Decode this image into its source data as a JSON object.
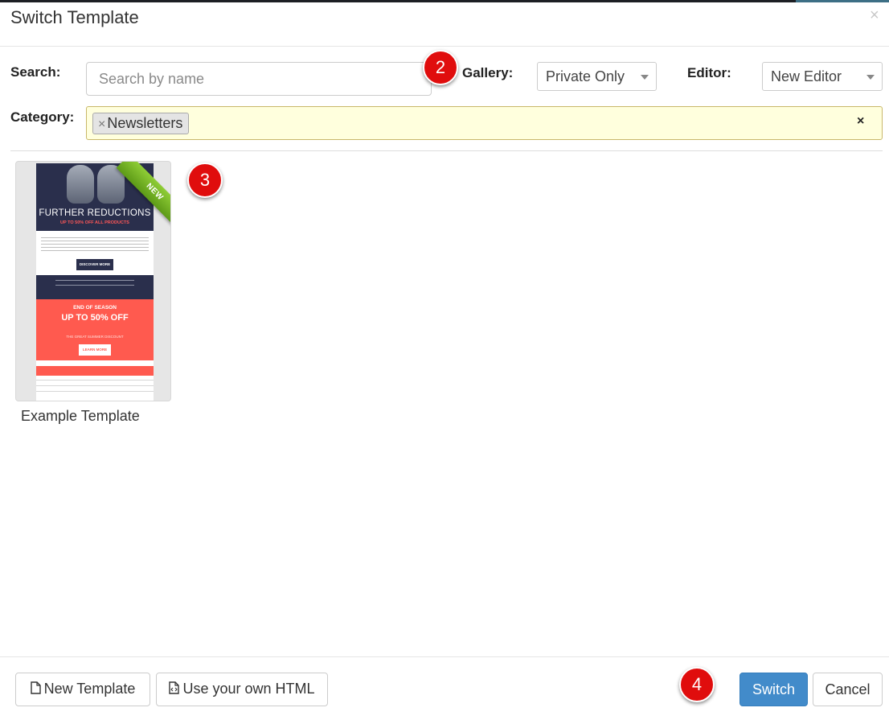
{
  "modal": {
    "title": "Switch Template",
    "close_glyph": "×"
  },
  "filters": {
    "search_label": "Search:",
    "search_placeholder": "Search by name",
    "gallery_label": "Gallery:",
    "gallery_value": "Private Only",
    "editor_label": "Editor:",
    "editor_value": "New Editor",
    "category_label": "Category:",
    "category_tag": "Newsletters",
    "category_tag_remove": "×",
    "category_clear": "×"
  },
  "annotations": {
    "badge_2": "2",
    "badge_3": "3",
    "badge_4": "4"
  },
  "templates": [
    {
      "name": "Example Template",
      "ribbon": "NEW",
      "thumb": {
        "headline": "FURTHER REDUCTIONS",
        "subhead": "UP TO 50% OFF ALL PRODUCTS",
        "button1": "DISCOVER MORE",
        "promo_kicker": "END OF SEASON",
        "promo_title": "UP TO 50% OFF",
        "promo_sub": "THE GREAT SUMMER DISCOUNT",
        "button2": "LEARN MORE"
      }
    }
  ],
  "footer": {
    "new_template": "New Template",
    "use_html": "Use your own HTML",
    "switch": "Switch",
    "cancel": "Cancel"
  }
}
